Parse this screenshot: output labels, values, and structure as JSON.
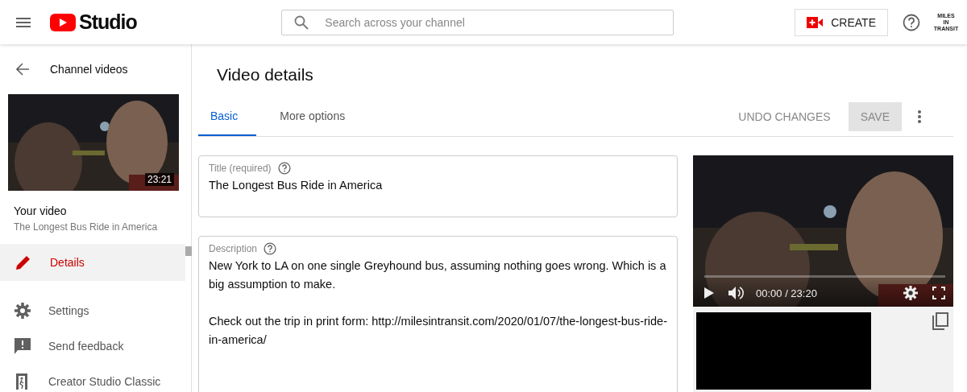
{
  "header": {
    "logo_text": "Studio",
    "search": {
      "placeholder": "Search across your channel"
    },
    "create_label": "CREATE",
    "avatar_lines": [
      "MILES",
      "IN",
      "TRANSIT"
    ]
  },
  "sidebar": {
    "back_label": "Channel videos",
    "thumbnail": {
      "kind": "picture",
      "duration": "23:21"
    },
    "your_video_label": "Your video",
    "video_title": "The Longest Bus Ride in America",
    "items": [
      {
        "kind": "details",
        "label": "Details",
        "selected": true
      },
      {
        "kind": "settings",
        "label": "Settings",
        "selected": false
      },
      {
        "kind": "feedback",
        "label": "Send feedback",
        "selected": false
      },
      {
        "kind": "classic",
        "label": "Creator Studio Classic",
        "selected": false
      }
    ]
  },
  "page_title": "Video details",
  "tabs": [
    {
      "label": "Basic",
      "selected": true
    },
    {
      "label": "More options",
      "selected": false
    }
  ],
  "actions": {
    "undo": "UNDO CHANGES",
    "save": "SAVE",
    "save_disabled": true
  },
  "fields": [
    {
      "label": "Title (required)",
      "value": "The Longest Bus Ride in America"
    },
    {
      "label": "Description",
      "value": "New York to LA on one single Greyhound bus, assuming nothing goes wrong. Which is a big assumption to make.\n\nCheck out the trip in print form: http://milesintransit.com/2020/01/07/the-longest-bus-ride-in-america/"
    }
  ],
  "player": {
    "kind": "picture",
    "time": "00:00 / 23:20"
  }
}
